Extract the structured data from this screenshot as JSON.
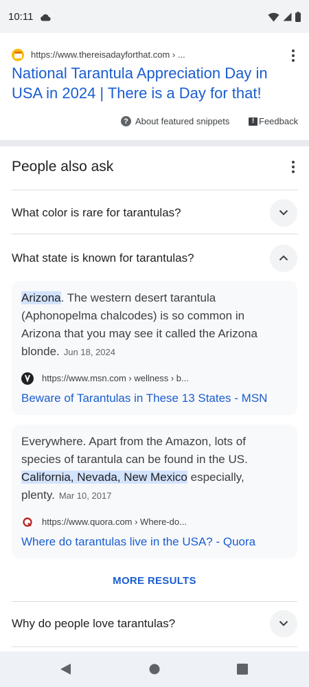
{
  "status": {
    "time": "10:11"
  },
  "result": {
    "url": "https://www.thereisadayforthat.com › ...",
    "title": "National Tarantula Appreciation Day in USA in 2024 | There is a Day for that!",
    "about_label": "About featured snippets",
    "feedback_label": "Feedback"
  },
  "paa": {
    "title": "People also ask",
    "questions": [
      {
        "text": "What color is rare for tarantulas?"
      },
      {
        "text": "What state is known for tarantulas?"
      },
      {
        "text": "Why do people love tarantulas?"
      }
    ],
    "answers": [
      {
        "highlight": "Arizona",
        "body": ". The western desert tarantula (Aphonopelma chalcodes) is so common in Arizona that you may see it called the Arizona blonde.",
        "date": "Jun 18, 2024",
        "source_url": "https://www.msn.com › wellness › b...",
        "link": "Beware of Tarantulas in These 13 States - MSN"
      },
      {
        "pre": "Everywhere. Apart from the Amazon, lots of species of tarantula can be found in the US. ",
        "highlight": "California, Nevada, New Mexico",
        "post": " especially, plenty.",
        "date": "Mar 10, 2017",
        "source_url": "https://www.quora.com › Where-do...",
        "link": "Where do tarantulas live in the USA? - Quora"
      }
    ],
    "more_results": "MORE RESULTS"
  },
  "colors": {
    "link": "#1a5dd0",
    "highlight": "#d3e3fd",
    "card_bg": "#f8f9fa",
    "quora": "#b92b27"
  }
}
